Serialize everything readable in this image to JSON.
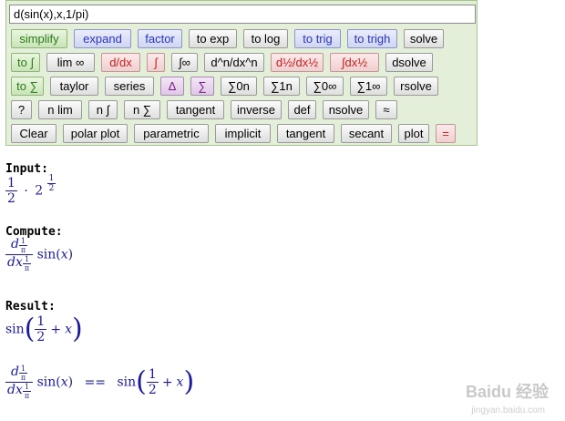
{
  "expression": {
    "value": "d(sin(x),x,1/pi)"
  },
  "buttons": {
    "row1": [
      "simplify",
      "expand",
      "factor",
      "to exp",
      "to log",
      "to trig",
      "to trigh",
      "solve"
    ],
    "row2": [
      "to ∫",
      "lim ∞",
      "d/dx",
      "∫",
      "∫∞",
      "d^n/dx^n",
      "d½/dx½",
      "∫dx½",
      "dsolve"
    ],
    "row3": [
      "to ∑",
      "taylor",
      "series",
      "Δ",
      "∑",
      "∑0n",
      "∑1n",
      "∑0∞",
      "∑1∞",
      "rsolve"
    ],
    "row4": [
      "?",
      "n lim",
      "n ∫",
      "n ∑",
      "tangent",
      "inverse",
      "def",
      "nsolve",
      "≈"
    ],
    "row5": [
      "Clear",
      "polar plot",
      "parametric",
      "implicit",
      "tangent",
      "secant",
      "plot",
      "="
    ]
  },
  "output": {
    "input_label": "Input:",
    "compute_label": "Compute:",
    "result_label": "Result:",
    "input_math": {
      "coef_num": "1",
      "coef_den": "2",
      "dot": "·",
      "base": "2",
      "exp_num": "1",
      "exp_den": "2"
    },
    "compute_math": {
      "d": "d",
      "dx": "dx",
      "order_num": "1",
      "order_den": "π",
      "func": "sin",
      "arg": "x"
    },
    "result_math": {
      "func": "sin",
      "half_num": "1",
      "half_den": "2",
      "plus": "+",
      "var": "x"
    },
    "equation": {
      "eq": "=="
    }
  },
  "watermark": {
    "brand": "Baidu 经验",
    "url": "jingyan.baidu.com"
  }
}
